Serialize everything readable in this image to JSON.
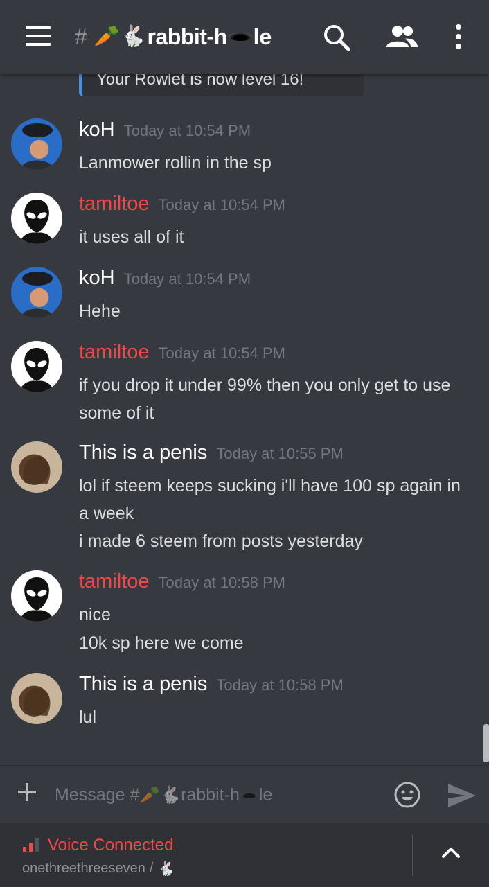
{
  "header": {
    "hash": "#",
    "emoji_carrot": "🥕",
    "emoji_rabbit": "🐇",
    "channel_name_prefix": "rabbit-h",
    "channel_name_suffix": "le",
    "icons": [
      "hamburger-menu-icon",
      "search-icon",
      "members-icon",
      "more-vertical-icon"
    ]
  },
  "embed": {
    "text": "Your Rowlet is now level 16!"
  },
  "messages": [
    {
      "author": "koH",
      "time": "Today at 10:54 PM",
      "author_color": "#ffffff",
      "lines": [
        "Lanmower rollin in the sp"
      ]
    },
    {
      "author": "tamiltoe",
      "time": "Today at 10:54 PM",
      "author_color": "#f04747",
      "lines": [
        "it uses all of it"
      ]
    },
    {
      "author": "koH",
      "time": "Today at 10:54 PM",
      "author_color": "#ffffff",
      "lines": [
        "Hehe"
      ]
    },
    {
      "author": "tamiltoe",
      "time": "Today at 10:54 PM",
      "author_color": "#f04747",
      "lines": [
        "if you drop it under 99% then you only get to use",
        "some of it"
      ]
    },
    {
      "author": "This is a penis",
      "time": "Today at 10:55 PM",
      "author_color": "#ffffff",
      "lines": [
        "lol if steem keeps sucking i'll have 100 sp again in",
        "a week",
        "i made 6 steem from posts yesterday"
      ]
    },
    {
      "author": "tamiltoe",
      "time": "Today at 10:58 PM",
      "author_color": "#f04747",
      "lines": [
        "nice",
        "10k sp here we come"
      ]
    },
    {
      "author": "This is a penis",
      "time": "Today at 10:58 PM",
      "author_color": "#ffffff",
      "lines": [
        "lul"
      ]
    }
  ],
  "input": {
    "placeholder_prefix": "Message #",
    "placeholder_name_prefix": "rabbit-h",
    "placeholder_name_suffix": "le",
    "emoji_carrot": "🥕",
    "emoji_rabbit": "🐇"
  },
  "voice": {
    "status": "Voice Connected",
    "server": "onethreethreeseven",
    "separator": "/",
    "emoji_rabbit": "🐇",
    "status_color": "#f04747"
  },
  "colors": {
    "background": "#36393f",
    "panel": "#2f3136",
    "danger": "#f04747",
    "embed_accent": "#4f8ed9"
  }
}
